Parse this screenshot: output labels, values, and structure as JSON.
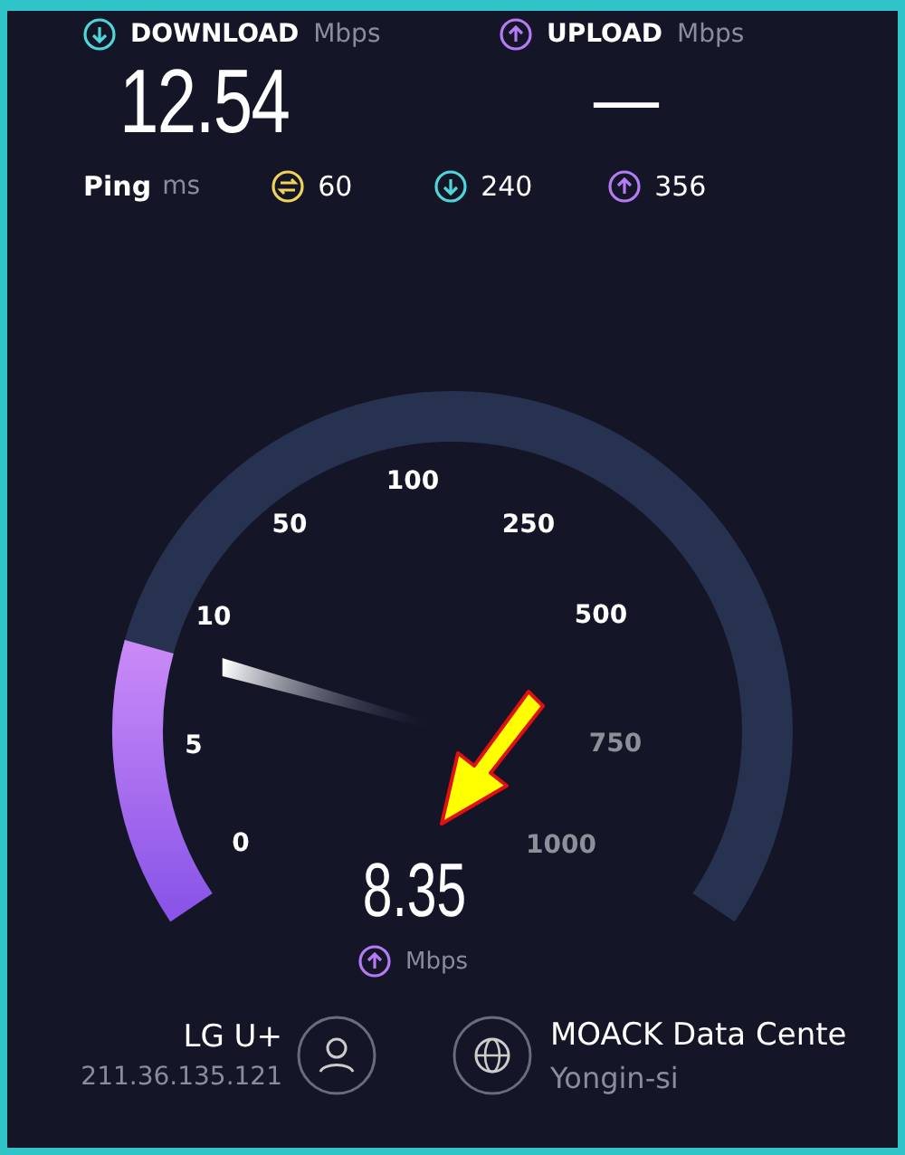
{
  "download": {
    "label": "DOWNLOAD",
    "unit": "Mbps",
    "value": "12.54"
  },
  "upload": {
    "label": "UPLOAD",
    "unit": "Mbps",
    "value": "—"
  },
  "ping": {
    "label": "Ping",
    "unit": "ms",
    "idle": "60",
    "down": "240",
    "up": "356"
  },
  "gauge": {
    "reading": "8.35",
    "unit": "Mbps",
    "ticks": [
      {
        "label": "0",
        "dim": false
      },
      {
        "label": "5",
        "dim": false
      },
      {
        "label": "10",
        "dim": false
      },
      {
        "label": "50",
        "dim": false
      },
      {
        "label": "100",
        "dim": false
      },
      {
        "label": "250",
        "dim": false
      },
      {
        "label": "500",
        "dim": false
      },
      {
        "label": "750",
        "dim": true
      },
      {
        "label": "1000",
        "dim": true
      }
    ]
  },
  "provider": {
    "name": "LG U+",
    "ip": "211.36.135.121"
  },
  "server": {
    "name": "MOACK Data Cente",
    "location": "Yongin-si"
  }
}
